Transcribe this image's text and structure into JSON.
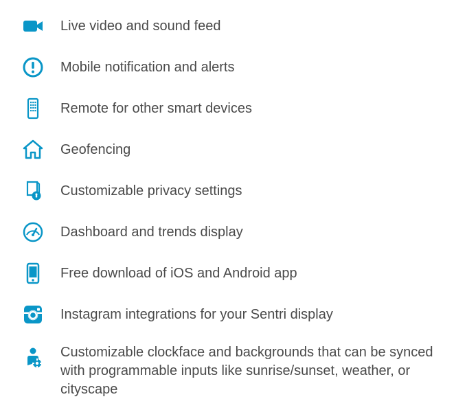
{
  "features": [
    {
      "icon": "video-icon",
      "text": "Live video and sound feed"
    },
    {
      "icon": "alert-icon",
      "text": "Mobile notification and alerts"
    },
    {
      "icon": "remote-icon",
      "text": "Remote for other smart devices"
    },
    {
      "icon": "home-icon",
      "text": "Geofencing"
    },
    {
      "icon": "privacy-icon",
      "text": "Customizable privacy settings"
    },
    {
      "icon": "gauge-icon",
      "text": "Dashboard and trends display"
    },
    {
      "icon": "phone-icon",
      "text": "Free download of iOS and Android app"
    },
    {
      "icon": "instagram-icon",
      "text": "Instagram integrations for your Sentri display"
    },
    {
      "icon": "user-gear-icon",
      "text": "Customizable clockface and backgrounds that can be synced with programmable inputs like sunrise/sunset, weather, or cityscape"
    }
  ],
  "colors": {
    "icon": "#0a96c7",
    "text": "#4a4a4a"
  }
}
